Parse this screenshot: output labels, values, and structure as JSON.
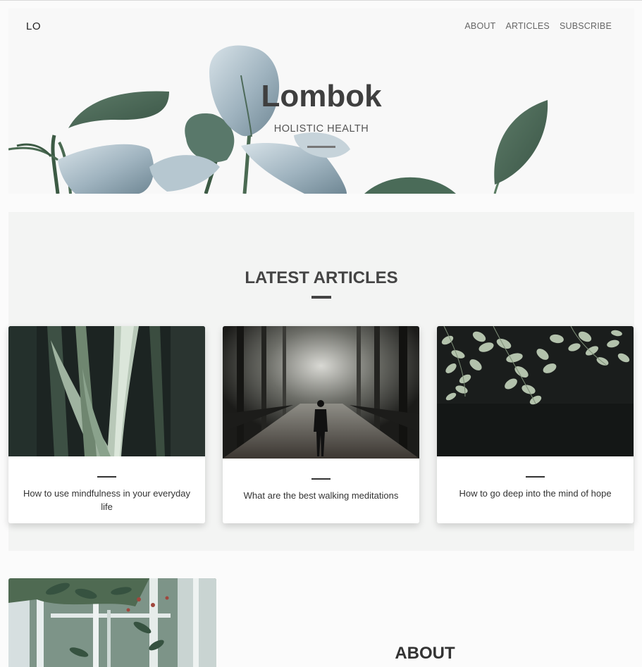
{
  "header": {
    "logo": "LO",
    "nav": [
      "ABOUT",
      "ARTICLES",
      "SUBSCRIBE"
    ]
  },
  "hero": {
    "title": "Lombok",
    "subtitle": "HOLISTIC HEALTH"
  },
  "latest": {
    "title": "LATEST ARTICLES",
    "articles": [
      {
        "title": "How to use mindfulness in your everyday life",
        "image": "tall-grass-leaves-photo"
      },
      {
        "title": "What are the best walking meditations",
        "image": "person-in-misty-forest-photo"
      },
      {
        "title": "How to go deep into the mind of hope",
        "image": "hanging-leaves-photo"
      }
    ]
  },
  "about": {
    "title": "ABOUT",
    "image": "greenhouse-photo"
  },
  "colors": {
    "accent": "#444444",
    "section_bg": "#f3f4f3",
    "leaf_green": "#4d6a58",
    "leaf_silver": "#a9bcc7"
  }
}
